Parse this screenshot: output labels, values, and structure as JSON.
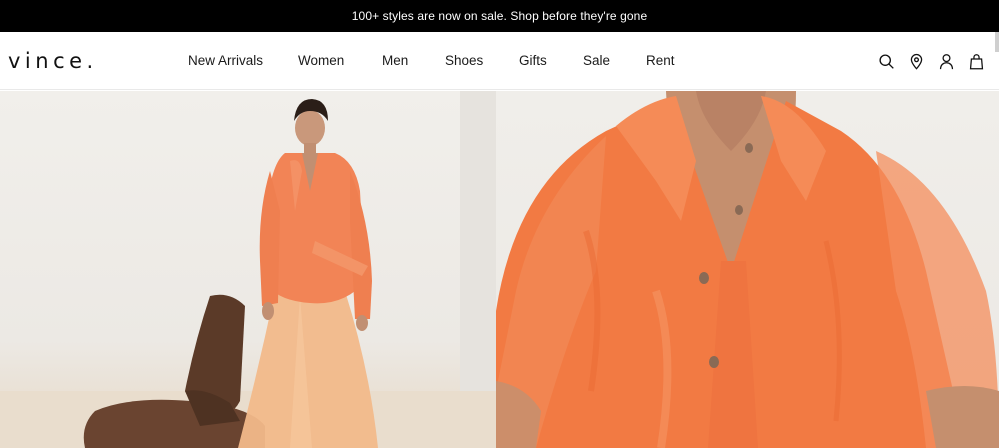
{
  "promo": {
    "text": "100+ styles are now on sale. Shop before they're gone"
  },
  "header": {
    "logo": "VINCE.",
    "nav": [
      {
        "label": "New Arrivals"
      },
      {
        "label": "Women"
      },
      {
        "label": "Men"
      },
      {
        "label": "Shoes"
      },
      {
        "label": "Gifts"
      },
      {
        "label": "Sale"
      },
      {
        "label": "Rent"
      }
    ],
    "icons": [
      "search-icon",
      "location-icon",
      "account-icon",
      "bag-icon"
    ]
  },
  "colors": {
    "promo_bg": "#000000",
    "accent_orange": "#f07a45",
    "skirt_peach": "#f2b98a",
    "chair_brown": "#5a3a28"
  }
}
